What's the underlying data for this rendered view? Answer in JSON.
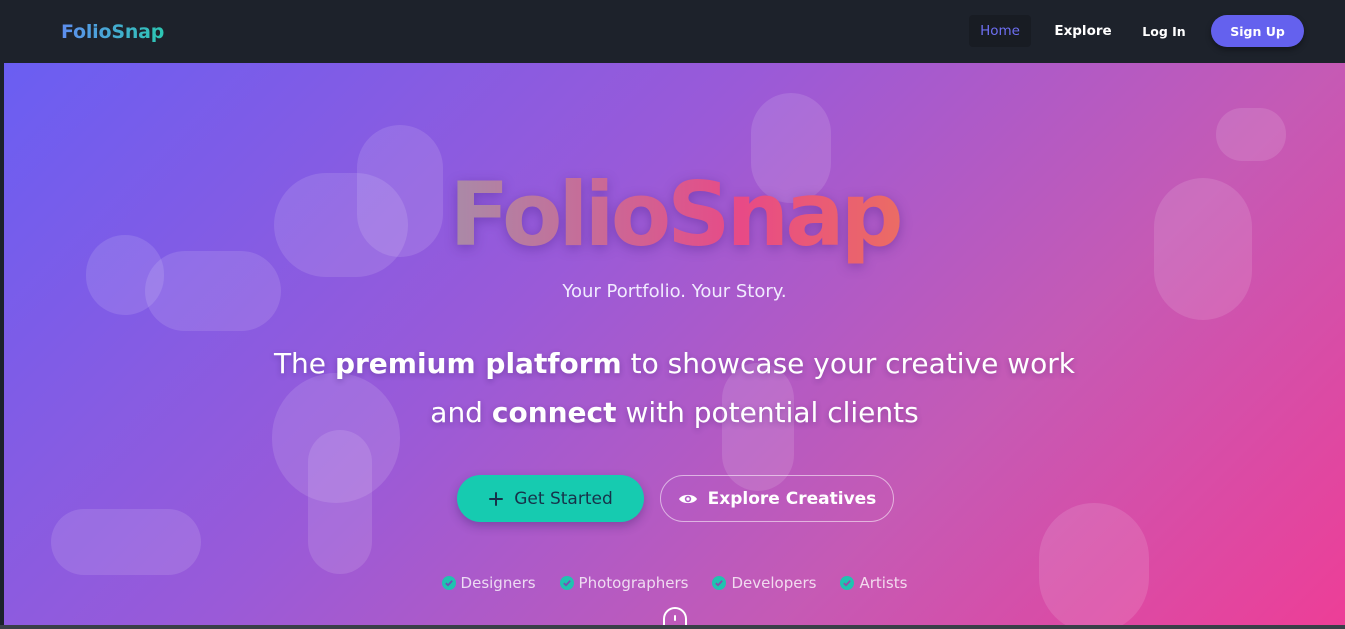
{
  "navbar": {
    "brand": "FolioSnap",
    "links": [
      {
        "label": "Home",
        "active": true
      },
      {
        "label": "Explore",
        "active": false
      },
      {
        "label": "Log In",
        "active": false
      }
    ],
    "signup_label": "Sign Up"
  },
  "hero": {
    "title": "FolioSnap",
    "tagline": "Your Portfolio. Your Story.",
    "headline": {
      "part1": "The ",
      "bold1": "premium platform",
      "part2": " to showcase your creative work",
      "part3": "and ",
      "bold2": "connect",
      "part4": " with potential clients"
    },
    "buttons": {
      "get_started": "Get Started",
      "explore_creatives": "Explore Creatives"
    },
    "categories": [
      "Designers",
      "Photographers",
      "Developers",
      "Artists"
    ]
  },
  "icons": {
    "plus": "plus-icon",
    "eye": "eye-icon",
    "check": "check-circle-icon",
    "scroll": "mouse-scroll-icon"
  },
  "colors": {
    "accent": "#6461ee",
    "teal": "#16cbb0",
    "navbar_bg": "#1d222b",
    "hero_gradient_start": "#6a5ef2",
    "hero_gradient_end": "#ed3e97"
  }
}
